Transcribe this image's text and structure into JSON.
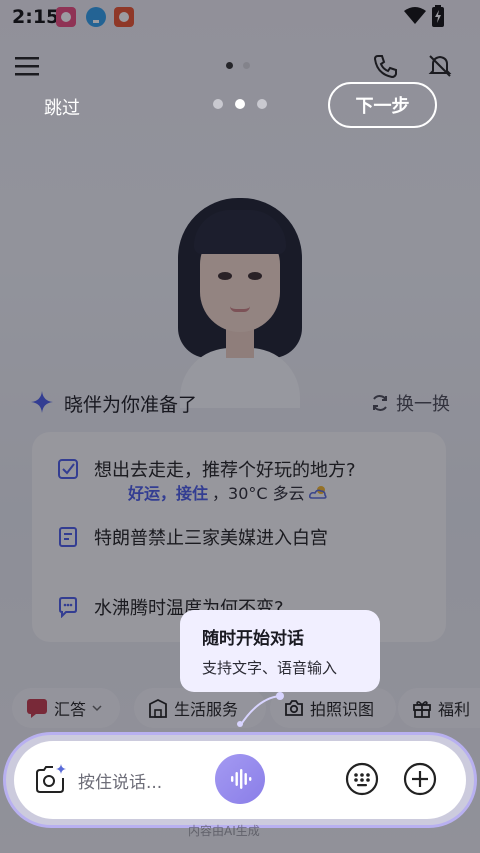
{
  "status_bar": {
    "time": "2:15",
    "notifications": [
      "app-notification-icon",
      "download-icon",
      "app-notification-icon"
    ]
  },
  "top_bar": {
    "icons": [
      "menu-icon",
      "phone-icon",
      "mute-icon"
    ]
  },
  "onboarding": {
    "skip_label": "跳过",
    "next_label": "下一步",
    "step_count": 3,
    "active_step": 2
  },
  "suggestions": {
    "title": "晓伴为你准备了",
    "refresh_label": "换一换",
    "items": [
      {
        "icon": "checkbox-icon",
        "text": "想出去走走，推荐个好玩的地方?"
      },
      {
        "icon": "news-icon",
        "text": "特朗普禁止三家美媒进入白宫"
      },
      {
        "icon": "chat-icon",
        "text": "水沸腾时温度为何不变?"
      }
    ]
  },
  "weather": {
    "fortune": "好运，接住",
    "temp": "，30°C 多云"
  },
  "chips": [
    {
      "icon": "chat-logo-icon",
      "label": "汇答"
    },
    {
      "icon": "building-icon",
      "label": "生活服务"
    },
    {
      "icon": "camera-icon",
      "label": "拍照识图"
    },
    {
      "icon": "gift-icon",
      "label": "福利"
    }
  ],
  "tooltip": {
    "title": "随时开始对话",
    "subtitle": "支持文字、语音输入"
  },
  "input": {
    "placeholder": "按住说话...",
    "disclaimer": "内容由AI生成"
  },
  "colors": {
    "accent": "#8a7ee8",
    "tooltip_bg": "#f1efff",
    "overlay": "#14141e"
  }
}
